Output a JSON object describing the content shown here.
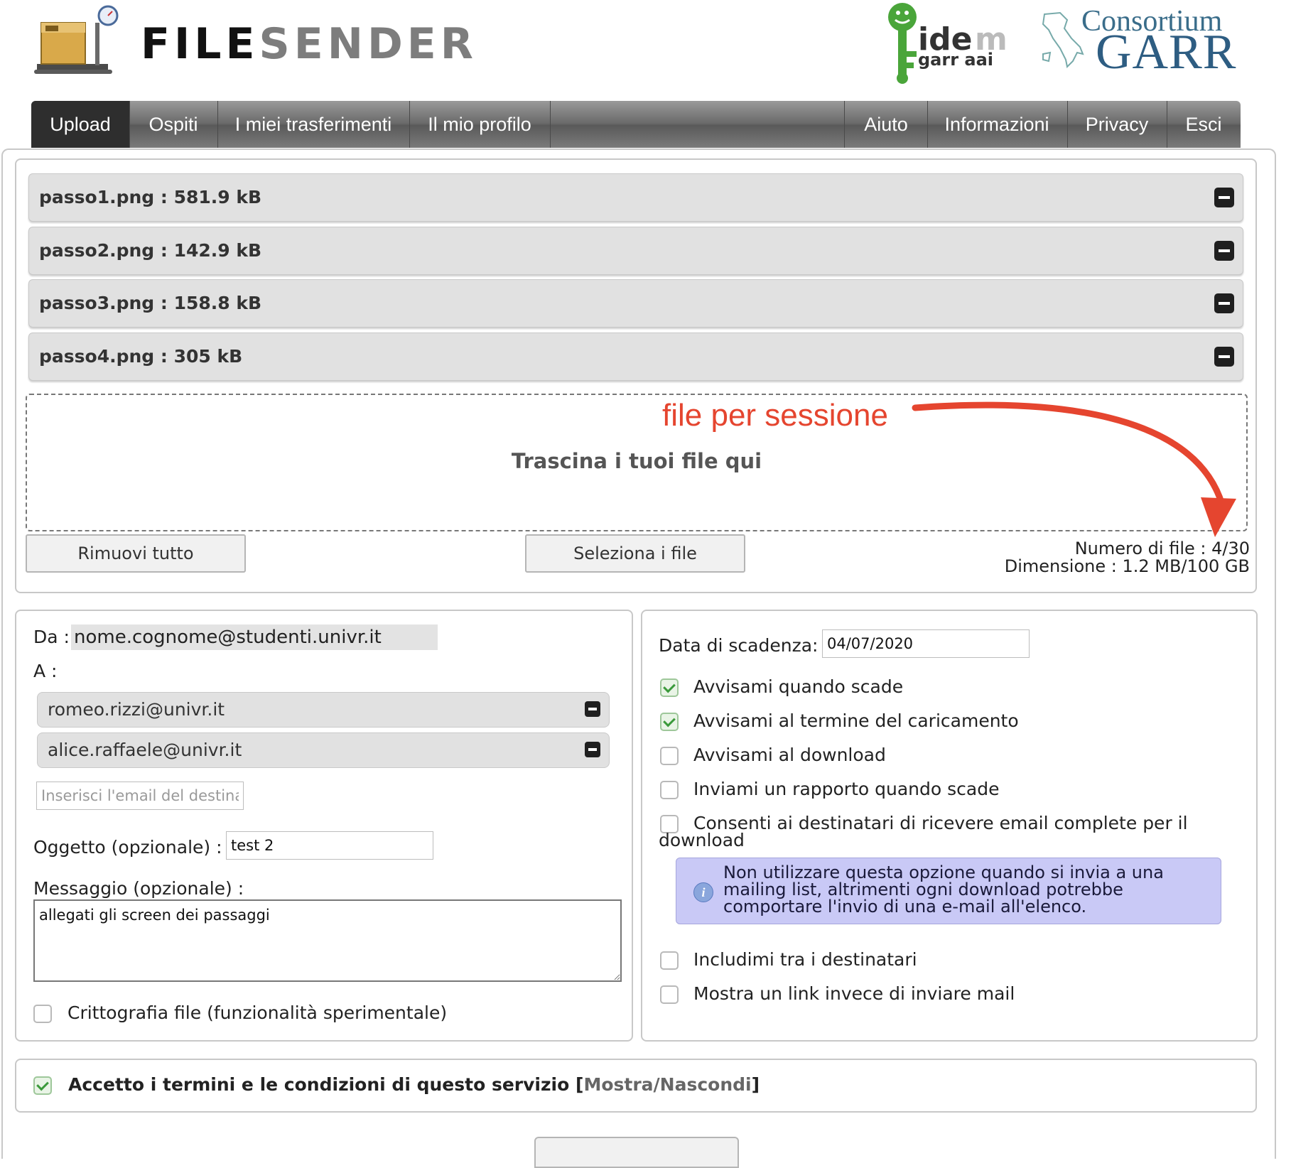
{
  "header": {
    "brand_part1": "FILE",
    "brand_part2": "SENDER",
    "logo_icon": "package-scale-icon",
    "partner_logo_1": "idem garr aai logo",
    "partner_logo_2_line1": "Consortium",
    "partner_logo_2_line2": "GARR"
  },
  "nav": {
    "tabs": [
      {
        "label": "Upload",
        "active": true
      },
      {
        "label": "Ospiti"
      },
      {
        "label": "I miei trasferimenti"
      },
      {
        "label": "Il mio profilo"
      },
      {
        "label": "Aiuto"
      },
      {
        "label": "Informazioni"
      },
      {
        "label": "Privacy"
      },
      {
        "label": "Esci"
      }
    ]
  },
  "files": {
    "items": [
      {
        "label": "passo1.png : 581.9 kB"
      },
      {
        "label": "passo2.png : 142.9 kB"
      },
      {
        "label": "passo3.png : 158.8 kB"
      },
      {
        "label": "passo4.png : 305 kB"
      }
    ],
    "drop_text": "Trascina i tuoi file qui",
    "annotation": "file per sessione",
    "remove_all": "Rimuovi tutto",
    "select_files": "Seleziona i file",
    "count_text": "Numero di file : 4/30",
    "size_text": "Dimensione : 1.2 MB/100 GB"
  },
  "form": {
    "from_label": "Da :",
    "from_value": "nome.cognome@studenti.univr.it",
    "to_label": "A :",
    "recipients": [
      "romeo.rizzi@univr.it",
      "alice.raffaele@univr.it"
    ],
    "email_placeholder": "Inserisci l'email del destinatario",
    "subject_label": "Oggetto (opzionale) :",
    "subject_value": "test 2",
    "message_label": "Messaggio (opzionale) :",
    "message_value": "allegati gli screen dei passaggi",
    "encryption_label": "Crittografia file (funzionalità sperimentale)"
  },
  "options": {
    "expiry_label": "Data di scadenza:",
    "expiry_value": "04/07/2020",
    "items": [
      {
        "label": "Avvisami quando scade",
        "checked": true
      },
      {
        "label": "Avvisami al termine del caricamento",
        "checked": true
      },
      {
        "label": "Avvisami al download",
        "checked": false
      },
      {
        "label": "Inviami un rapporto quando scade",
        "checked": false
      },
      {
        "label": "Consenti ai destinatari di ricevere email complete per il",
        "label_cont": "download",
        "checked": false
      },
      {
        "label": "Includimi tra i destinatari",
        "checked": false
      },
      {
        "label": "Mostra un link invece di inviare mail",
        "checked": false
      }
    ],
    "info_text": "Non utilizzare questa opzione quando si invia a una mailing list, altrimenti ogni download potrebbe comportare l'invio di una e-mail all'elenco."
  },
  "terms": {
    "label": "Accetto i termini e le condizioni di questo servizio",
    "link_open": "[",
    "link_text": "Mostra/Nascondi",
    "link_close": "]",
    "checked": true
  },
  "colors": {
    "annotation": "#e5452f",
    "info_bg": "#c9c9f6",
    "nav_active": "#2e2e2e",
    "check_green": "#3b9a3b"
  }
}
